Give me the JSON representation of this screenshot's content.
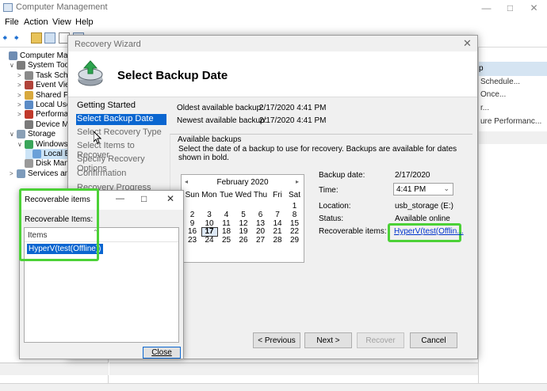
{
  "main_window": {
    "title": "Computer Management",
    "menu": [
      "File",
      "Action",
      "View",
      "Help"
    ],
    "tree": [
      {
        "label": "Computer Manag",
        "indent": 0,
        "icon": "computer-icon"
      },
      {
        "label": "System Tools",
        "indent": 1,
        "icon": "tools-icon",
        "expander": "∨"
      },
      {
        "label": "Task Schec",
        "indent": 2,
        "icon": "clock-icon",
        "expander": ">"
      },
      {
        "label": "Event View",
        "indent": 2,
        "icon": "event-icon",
        "expander": ">"
      },
      {
        "label": "Shared Fol",
        "indent": 2,
        "icon": "folder-icon",
        "expander": ">"
      },
      {
        "label": "Local User",
        "indent": 2,
        "icon": "users-icon",
        "expander": ">"
      },
      {
        "label": "Performan",
        "indent": 2,
        "icon": "performance-icon",
        "expander": ">"
      },
      {
        "label": "Device Mai",
        "indent": 2,
        "icon": "device-icon",
        "expander": ""
      },
      {
        "label": "Storage",
        "indent": 1,
        "icon": "storage-icon",
        "expander": "∨"
      },
      {
        "label": "Windows S",
        "indent": 2,
        "icon": "backup-icon",
        "expander": "∨"
      },
      {
        "label": "Local B",
        "indent": 3,
        "icon": "local-backup-icon",
        "expander": ""
      },
      {
        "label": "Disk Mana",
        "indent": 2,
        "icon": "disk-icon",
        "expander": ""
      },
      {
        "label": "Services and A",
        "indent": 1,
        "icon": "services-icon",
        "expander": ">"
      }
    ],
    "actions": [
      "p",
      "Schedule...",
      "Once...",
      "r...",
      "",
      "ure Performanc..."
    ]
  },
  "wizard": {
    "title": "Recovery Wizard",
    "heading": "Select Backup Date",
    "steps": [
      {
        "label": "Getting Started",
        "state": "done"
      },
      {
        "label": "Select Backup Date",
        "state": "active"
      },
      {
        "label": "Select Recovery Type",
        "state": "pending"
      },
      {
        "label": "Select Items to Recover",
        "state": "pending"
      },
      {
        "label": "Specify Recovery Options",
        "state": "pending"
      },
      {
        "label": "Confirmation",
        "state": "pending"
      },
      {
        "label": "Recovery Progress",
        "state": "pending"
      }
    ],
    "oldest_label": "Oldest available backup:",
    "oldest_value": "2/17/2020 4:41 PM",
    "newest_label": "Newest available backup:",
    "newest_value": "2/17/2020 4:41 PM",
    "available_title": "Available backups",
    "available_desc": "Select the date of a backup to use for recovery. Backups are available for dates shown in bold.",
    "calendar": {
      "month": "February 2020",
      "weekdays": [
        "Sun",
        "Mon",
        "Tue",
        "Wed",
        "Thu",
        "Fri",
        "Sat"
      ],
      "weeks": [
        [
          "",
          "",
          "",
          "",
          "",
          "",
          "1"
        ],
        [
          "2",
          "3",
          "4",
          "5",
          "6",
          "7",
          "8"
        ],
        [
          "9",
          "10",
          "11",
          "12",
          "13",
          "14",
          "15"
        ],
        [
          "16",
          "17",
          "18",
          "19",
          "20",
          "21",
          "22"
        ],
        [
          "23",
          "24",
          "25",
          "26",
          "27",
          "28",
          "29"
        ]
      ],
      "selected": "17",
      "prev": "◂",
      "next": "▸"
    },
    "backup_date_label": "Backup date:",
    "backup_date_value": "2/17/2020",
    "time_label": "Time:",
    "time_value": "4:41 PM",
    "location_label": "Location:",
    "location_value": "usb_storage (E:)",
    "status_label": "Status:",
    "status_value": "Available online",
    "recoverable_label": "Recoverable items:",
    "recoverable_link": "HyperV(test(Offlin...",
    "buttons": {
      "previous": "< Previous",
      "next": "Next >",
      "recover": "Recover",
      "cancel": "Cancel"
    }
  },
  "rec_dialog": {
    "title": "Recoverable items",
    "label": "Recoverable Items:",
    "column": "Items",
    "items": [
      "HyperV(test(Offline))"
    ],
    "close": "Close"
  },
  "colors": {
    "highlight_green": "#4cd137",
    "selection_blue": "#0a66d0"
  }
}
